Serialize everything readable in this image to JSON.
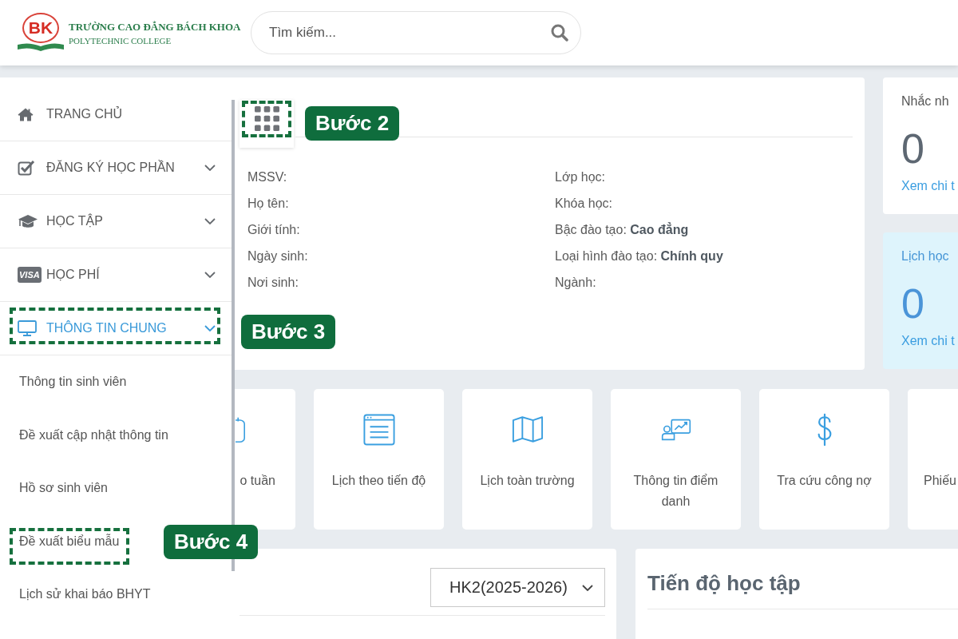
{
  "header": {
    "logo": {
      "mark": "BK",
      "title": "TRƯỜNG CAO ĐẲNG BÁCH KHOA",
      "subtitle": "POLYTECHNIC COLLEGE"
    },
    "search": {
      "placeholder": "Tìm kiếm..."
    }
  },
  "sidebar": {
    "items": [
      {
        "label": "TRANG CHỦ",
        "expandable": false,
        "expanded": false,
        "highlighted": false
      },
      {
        "label": "ĐĂNG KÝ HỌC PHẦN",
        "expandable": true,
        "expanded": false,
        "highlighted": false
      },
      {
        "label": "HỌC TẬP",
        "expandable": true,
        "expanded": false,
        "highlighted": false
      },
      {
        "label": "HỌC PHÍ",
        "icon_text": "VISA",
        "expandable": true,
        "expanded": false,
        "highlighted": false
      },
      {
        "label": "THÔNG TIN CHUNG",
        "expandable": true,
        "expanded": true,
        "highlighted": true,
        "step": "Bước 3",
        "children": [
          {
            "label": "Thông tin sinh viên",
            "highlighted": false
          },
          {
            "label": "Đề xuất cập nhật thông tin",
            "highlighted": false
          },
          {
            "label": "Hồ sơ sinh viên",
            "highlighted": false
          },
          {
            "label": "Đề xuất biểu mẫu",
            "highlighted": true,
            "step": "Bước 4"
          },
          {
            "label": "Lịch sử khai báo BHYT",
            "highlighted": false
          }
        ]
      }
    ]
  },
  "student_card": {
    "apps_button": {
      "highlighted": true,
      "step": "Bước 2"
    },
    "fields_left": [
      {
        "label": "MSSV:"
      },
      {
        "label": "Họ tên:"
      },
      {
        "label": "Giới tính:"
      },
      {
        "label": "Ngày sinh:"
      },
      {
        "label": "Nơi sinh:"
      }
    ],
    "fields_right": [
      {
        "label": "Lớp học:"
      },
      {
        "label": "Khóa học:"
      },
      {
        "label": "Bậc đào tạo:",
        "value": "Cao đẳng"
      },
      {
        "label": "Loại hình đào tạo:",
        "value": "Chính quy"
      },
      {
        "label": "Ngành:"
      }
    ]
  },
  "stat_cards": [
    {
      "kind": "plain",
      "title": "Nhắc nh",
      "count": "0",
      "link": "Xem chi t"
    },
    {
      "kind": "info",
      "title": "Lịch học",
      "count": "0",
      "link": "Xem chi t"
    }
  ],
  "shortcut_tiles": [
    {
      "label": "o tuần"
    },
    {
      "label": "Lịch theo tiến độ"
    },
    {
      "label": "Lịch toàn trường"
    },
    {
      "label": "Thông tin điểm danh"
    },
    {
      "label": "Tra cứu công nợ"
    },
    {
      "label": "Phiếu"
    }
  ],
  "semester_panel": {
    "select": {
      "value": "HK2(2025-2026)"
    }
  },
  "progress_panel": {
    "title": "Tiến độ học tập"
  }
}
